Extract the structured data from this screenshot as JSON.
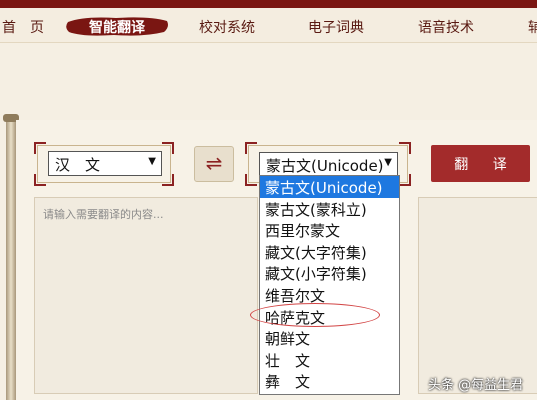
{
  "nav": {
    "items": [
      "首　页",
      "校对系统",
      "电子词典",
      "语音技术",
      "辅"
    ],
    "active": "智能翻译"
  },
  "source_select": {
    "value": "汉　文"
  },
  "target_select": {
    "value": "蒙古文(Unicode)"
  },
  "translate_label": "翻 译",
  "input_placeholder": "请输入需要翻译的内容...",
  "dropdown": {
    "options": [
      "蒙古文(Unicode)",
      "蒙古文(蒙科立)",
      "西里尔蒙文",
      "藏文(大字符集)",
      "藏文(小字符集)",
      "维吾尔文",
      "哈萨克文",
      "朝鲜文",
      "壮　文",
      "彝　文"
    ],
    "selected_index": 0,
    "circled_index": 6
  },
  "watermark": "头条 @每益生君",
  "colors": {
    "brand_red": "#a32b2b",
    "dark_red": "#7a1612",
    "selection_blue": "#1e78e0"
  }
}
